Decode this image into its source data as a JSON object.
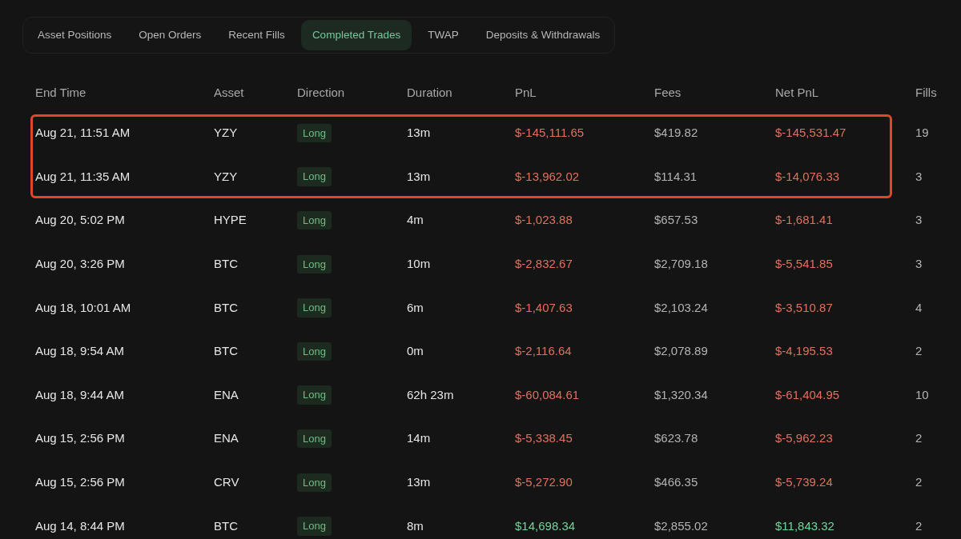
{
  "tabs": [
    {
      "label": "Asset Positions",
      "selected": false
    },
    {
      "label": "Open Orders",
      "selected": false
    },
    {
      "label": "Recent Fills",
      "selected": false
    },
    {
      "label": "Completed Trades",
      "selected": true
    },
    {
      "label": "TWAP",
      "selected": false
    },
    {
      "label": "Deposits & Withdrawals",
      "selected": false
    }
  ],
  "table": {
    "columns": [
      "End Time",
      "Asset",
      "Direction",
      "Duration",
      "PnL",
      "Fees",
      "Net PnL",
      "Fills"
    ],
    "rows": [
      {
        "end_time": "Aug 21, 11:51 AM",
        "asset": "YZY",
        "direction": "Long",
        "duration": "13m",
        "pnl": "$-145,111.65",
        "fees": "$419.82",
        "net_pnl": "$-145,531.47",
        "fills": "19",
        "profit": false,
        "highlighted": true
      },
      {
        "end_time": "Aug 21, 11:35 AM",
        "asset": "YZY",
        "direction": "Long",
        "duration": "13m",
        "pnl": "$-13,962.02",
        "fees": "$114.31",
        "net_pnl": "$-14,076.33",
        "fills": "3",
        "profit": false,
        "highlighted": true
      },
      {
        "end_time": "Aug 20, 5:02 PM",
        "asset": "HYPE",
        "direction": "Long",
        "duration": "4m",
        "pnl": "$-1,023.88",
        "fees": "$657.53",
        "net_pnl": "$-1,681.41",
        "fills": "3",
        "profit": false,
        "highlighted": false
      },
      {
        "end_time": "Aug 20, 3:26 PM",
        "asset": "BTC",
        "direction": "Long",
        "duration": "10m",
        "pnl": "$-2,832.67",
        "fees": "$2,709.18",
        "net_pnl": "$-5,541.85",
        "fills": "3",
        "profit": false,
        "highlighted": false
      },
      {
        "end_time": "Aug 18, 10:01 AM",
        "asset": "BTC",
        "direction": "Long",
        "duration": "6m",
        "pnl": "$-1,407.63",
        "fees": "$2,103.24",
        "net_pnl": "$-3,510.87",
        "fills": "4",
        "profit": false,
        "highlighted": false
      },
      {
        "end_time": "Aug 18, 9:54 AM",
        "asset": "BTC",
        "direction": "Long",
        "duration": "0m",
        "pnl": "$-2,116.64",
        "fees": "$2,078.89",
        "net_pnl": "$-4,195.53",
        "fills": "2",
        "profit": false,
        "highlighted": false
      },
      {
        "end_time": "Aug 18, 9:44 AM",
        "asset": "ENA",
        "direction": "Long",
        "duration": "62h 23m",
        "pnl": "$-60,084.61",
        "fees": "$1,320.34",
        "net_pnl": "$-61,404.95",
        "fills": "10",
        "profit": false,
        "highlighted": false
      },
      {
        "end_time": "Aug 15, 2:56 PM",
        "asset": "ENA",
        "direction": "Long",
        "duration": "14m",
        "pnl": "$-5,338.45",
        "fees": "$623.78",
        "net_pnl": "$-5,962.23",
        "fills": "2",
        "profit": false,
        "highlighted": false
      },
      {
        "end_time": "Aug 15, 2:56 PM",
        "asset": "CRV",
        "direction": "Long",
        "duration": "13m",
        "pnl": "$-5,272.90",
        "fees": "$466.35",
        "net_pnl": "$-5,739.24",
        "fills": "2",
        "profit": false,
        "highlighted": false
      },
      {
        "end_time": "Aug 14, 8:44 PM",
        "asset": "BTC",
        "direction": "Long",
        "duration": "8m",
        "pnl": "$14,698.34",
        "fees": "$2,855.02",
        "net_pnl": "$11,843.32",
        "fills": "2",
        "profit": true,
        "highlighted": false
      }
    ]
  }
}
